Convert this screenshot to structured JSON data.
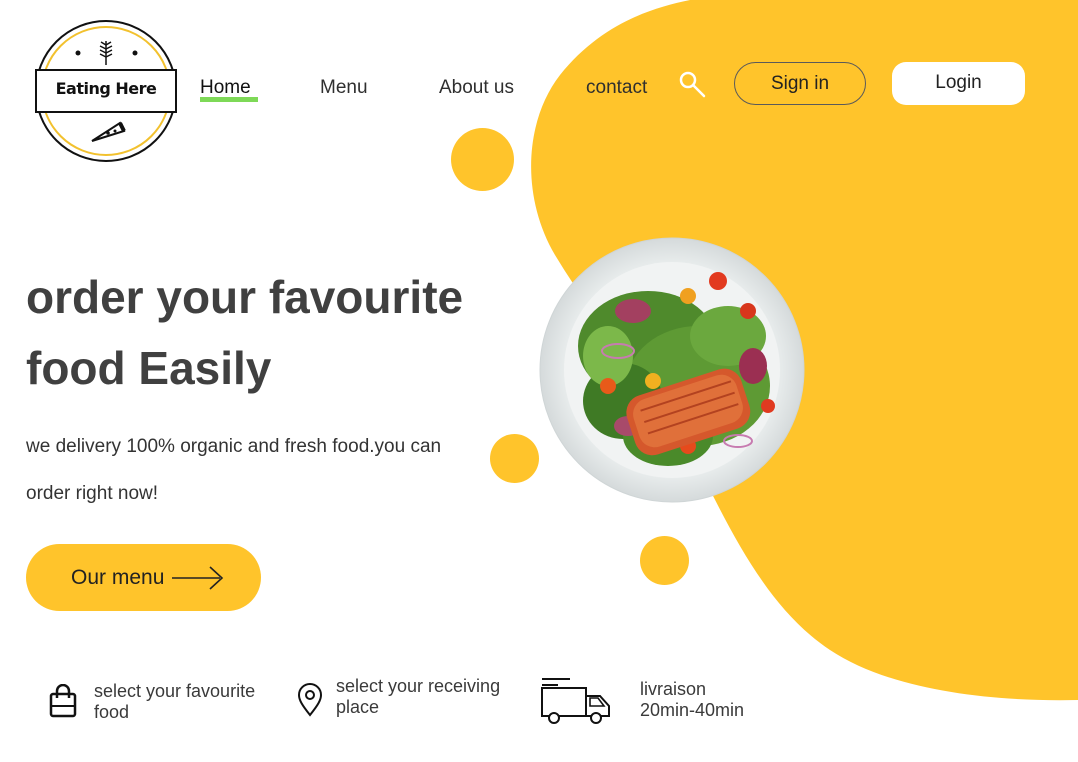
{
  "brand": {
    "logo_text": "Eating Here"
  },
  "nav": {
    "home": "Home",
    "menu": "Menu",
    "about": "About us",
    "contact": "contact"
  },
  "auth": {
    "signin": "Sign in",
    "login": "Login"
  },
  "hero": {
    "title_line1": "order your favourite",
    "title_line2": "food Easily",
    "subtitle_line1": "we delivery 100% organic and fresh food.you can",
    "subtitle_line2": "order right now!",
    "cta": "Our menu"
  },
  "features": [
    {
      "icon": "shopping-bag-icon",
      "line1": "select your favourite",
      "line2": "food"
    },
    {
      "icon": "location-pin-icon",
      "line1": "select  your receiving",
      "line2": "place"
    },
    {
      "icon": "delivery-truck-icon",
      "line1": "livraison",
      "line2": "20min-40min"
    }
  ],
  "colors": {
    "accent": "#FFC42B",
    "active_underline": "#7ED957",
    "text": "#3a3a3a"
  }
}
